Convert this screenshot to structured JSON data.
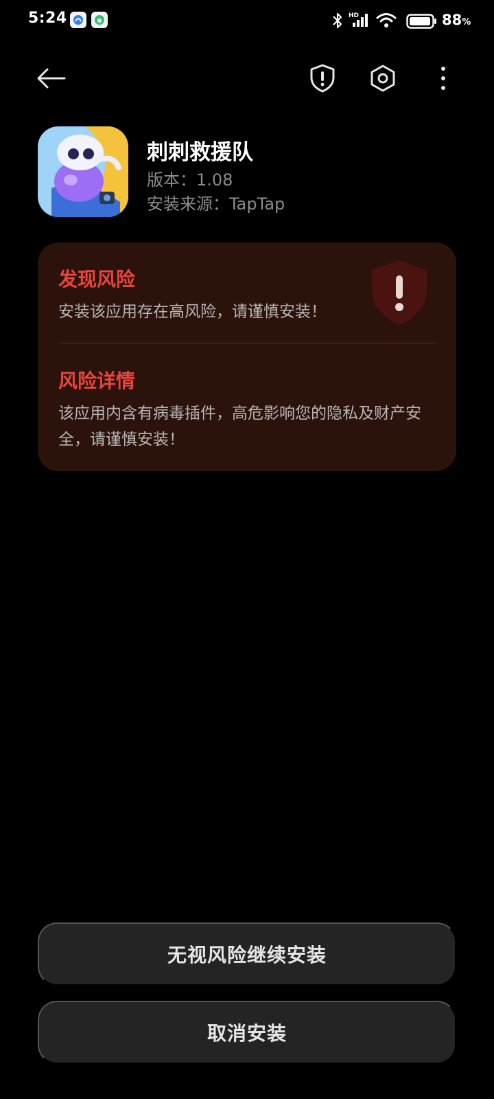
{
  "status_bar": {
    "time": "5:24",
    "battery_value": "88",
    "battery_unit": "%",
    "icons": [
      "notification-app-icon",
      "notification-app-icon",
      "bluetooth-icon",
      "hd-signal-icon",
      "wifi-icon",
      "battery-icon"
    ]
  },
  "toolbar": {
    "icons": [
      "back-arrow-icon",
      "shield-alert-icon",
      "hexagon-settings-icon",
      "more-vertical-icon"
    ]
  },
  "app": {
    "name": "刺刺救援队",
    "version": "版本：1.08",
    "source": "安装来源：TapTap"
  },
  "risk": {
    "found_title": "发现风险",
    "found_text": "安装该应用存在高风险，请谨慎安装！",
    "details_title": "风险详情",
    "details_text": "该应用内含有病毒插件，高危影响您的隐私及财产安全，请谨慎安装！",
    "accent_color": "#e8453c",
    "card_color": "#2b120b"
  },
  "actions": {
    "continue_label": "无视风险继续安装",
    "cancel_label": "取消安装"
  }
}
